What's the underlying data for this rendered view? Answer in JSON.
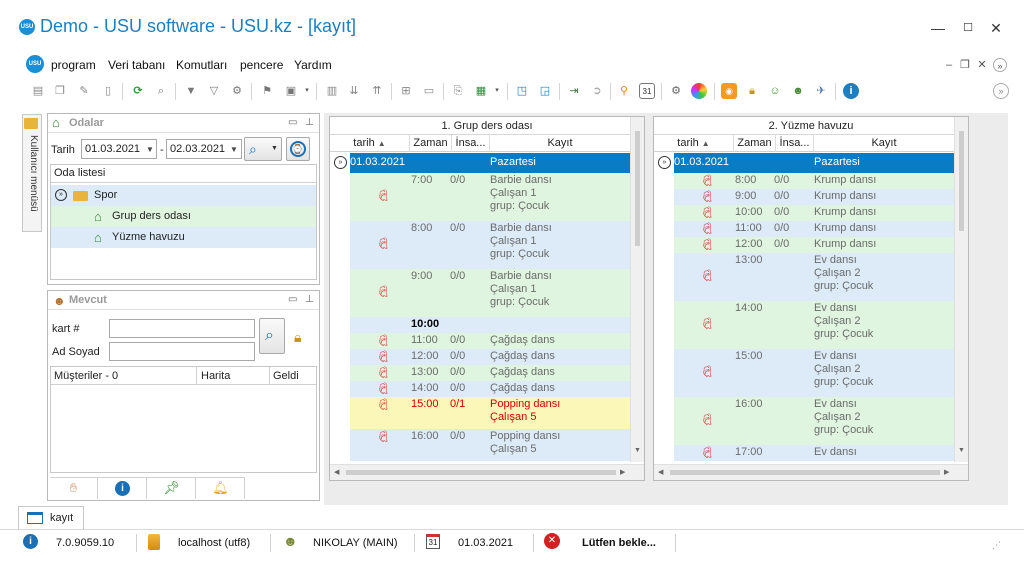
{
  "window": {
    "title": "Demo - USU software - USU.kz - [kayıt]",
    "app_logo": "USU"
  },
  "menu": {
    "items": [
      "program",
      "Veri tabanı",
      "Komutları",
      "pencere",
      "Yardım"
    ]
  },
  "side_tab": {
    "label": "Kullanıcı menüsü"
  },
  "odalar": {
    "title": "Odalar",
    "date_label": "Tarih",
    "date_from": "01.03.2021",
    "date_sep": "-",
    "date_to": "02.03.2021",
    "list_header": "Oda listesi",
    "tree": {
      "group": "Spor",
      "rooms": [
        "Grup ders odası",
        "Yüzme havuzu"
      ]
    }
  },
  "mevcut": {
    "title": "Mevcut",
    "kart_label": "kart #",
    "kart_value": "",
    "adsoyad_label": "Ad Soyad",
    "adsoyad_value": "",
    "columns": [
      "Müşteriler - 0",
      "Harita",
      "Geldi"
    ]
  },
  "grid1": {
    "title": "1. Grup ders odası",
    "columns": [
      "tarih",
      "Zaman",
      "İnsa...",
      "Kayıt"
    ],
    "group_date": "01.03.2021",
    "group_day": "Pazartesi",
    "rows": [
      {
        "time": "7:00",
        "count": "0/0",
        "lines": [
          "Barbie dansı",
          "Çalışan 1",
          "grup: Çocuk"
        ],
        "style": "green"
      },
      {
        "time": "8:00",
        "count": "0/0",
        "lines": [
          "Barbie dansı",
          "Çalışan 1",
          "grup: Çocuk"
        ],
        "style": "blue"
      },
      {
        "time": "9:00",
        "count": "0/0",
        "lines": [
          "Barbie dansı",
          "Çalışan 1",
          "grup: Çocuk"
        ],
        "style": "green"
      },
      {
        "time": "10:00",
        "count": "",
        "lines": [
          ""
        ],
        "style": "blue",
        "bold": true
      },
      {
        "time": "11:00",
        "count": "0/0",
        "lines": [
          "Çağdaş dans"
        ],
        "style": "green"
      },
      {
        "time": "12:00",
        "count": "0/0",
        "lines": [
          "Çağdaş dans"
        ],
        "style": "blue"
      },
      {
        "time": "13:00",
        "count": "0/0",
        "lines": [
          "Çağdaş dans"
        ],
        "style": "green"
      },
      {
        "time": "14:00",
        "count": "0/0",
        "lines": [
          "Çağdaş dans"
        ],
        "style": "blue"
      },
      {
        "time": "15:00",
        "count": "0/1",
        "lines": [
          "Popping dansı",
          "Çalışan 5"
        ],
        "style": "yellow"
      },
      {
        "time": "16:00",
        "count": "0/0",
        "lines": [
          "Popping dansı",
          "Çalışan 5"
        ],
        "style": "blue"
      }
    ]
  },
  "grid2": {
    "title": "2. Yüzme havuzu",
    "columns": [
      "tarih",
      "Zaman",
      "İnsa...",
      "Kayıt"
    ],
    "group_date": "01.03.2021",
    "group_day": "Pazartesi",
    "rows": [
      {
        "time": "8:00",
        "count": "0/0",
        "lines": [
          "Krump dansı"
        ],
        "style": "green"
      },
      {
        "time": "9:00",
        "count": "0/0",
        "lines": [
          "Krump dansı"
        ],
        "style": "blue"
      },
      {
        "time": "10:00",
        "count": "0/0",
        "lines": [
          "Krump dansı"
        ],
        "style": "green"
      },
      {
        "time": "11:00",
        "count": "0/0",
        "lines": [
          "Krump dansı"
        ],
        "style": "blue"
      },
      {
        "time": "12:00",
        "count": "0/0",
        "lines": [
          "Krump dansı"
        ],
        "style": "green"
      },
      {
        "time": "13:00",
        "count": "",
        "lines": [
          "Ev dansı",
          "Çalışan 2",
          "grup: Çocuk"
        ],
        "style": "blue"
      },
      {
        "time": "14:00",
        "count": "",
        "lines": [
          "Ev dansı",
          "Çalışan 2",
          "grup: Çocuk"
        ],
        "style": "green"
      },
      {
        "time": "15:00",
        "count": "",
        "lines": [
          "Ev dansı",
          "Çalışan 2",
          "grup: Çocuk"
        ],
        "style": "blue"
      },
      {
        "time": "16:00",
        "count": "",
        "lines": [
          "Ev dansı",
          "Çalışan 2",
          "grup: Çocuk"
        ],
        "style": "green"
      },
      {
        "time": "17:00",
        "count": "",
        "lines": [
          "Ev dansı"
        ],
        "style": "blue"
      }
    ]
  },
  "bottom_tab": {
    "label": "kayıt"
  },
  "status": {
    "version": "7.0.9059.10",
    "db": "localhost (utf8)",
    "user": "NIKOLAY (MAIN)",
    "date": "01.03.2021",
    "calendar_day": "31",
    "message": "Lütfen bekle..."
  },
  "colors": {
    "accent": "#1b7fc4",
    "group_row": "#0a7cc6",
    "row_green": "#dff5df",
    "row_blue": "#dcebf7",
    "row_yellow": "#fbf7b8",
    "highlight_text": "#d40000"
  }
}
